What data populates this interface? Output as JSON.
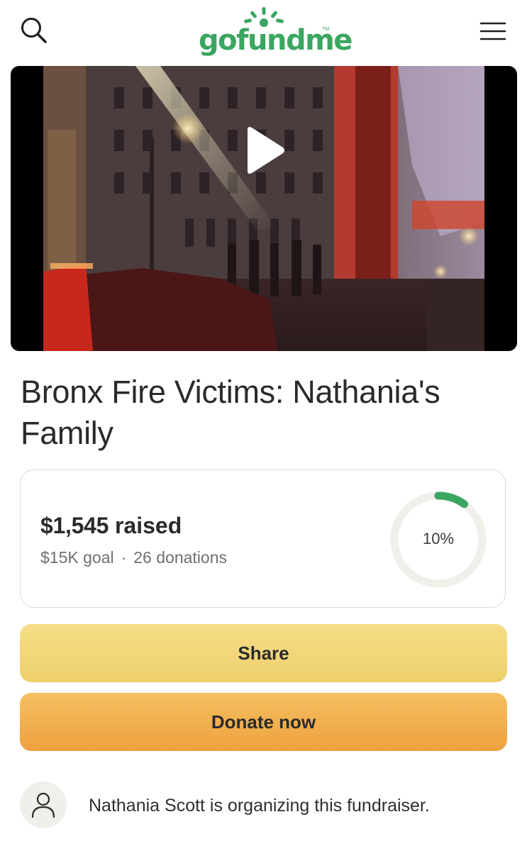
{
  "header": {
    "logo_text": "gofundme",
    "logo_tm": "TM",
    "search_icon": "search-icon",
    "menu_icon": "hamburger-menu-icon",
    "brand_color": "#3aa660"
  },
  "video": {
    "play_icon": "play-icon"
  },
  "campaign": {
    "title": "Bronx Fire Victims: Nathania's Family"
  },
  "stats": {
    "raised_amount": "$1,545",
    "raised_label": "raised",
    "goal": "$15K goal",
    "separator": "·",
    "donations": "26 donations",
    "progress_percent": 10,
    "progress_label": "10%",
    "progress_color": "#3aa660",
    "track_color": "#f0efea"
  },
  "actions": {
    "share_label": "Share",
    "donate_label": "Donate now"
  },
  "organizer": {
    "icon": "user-icon",
    "text": "Nathania Scott is organizing this fundraiser."
  }
}
